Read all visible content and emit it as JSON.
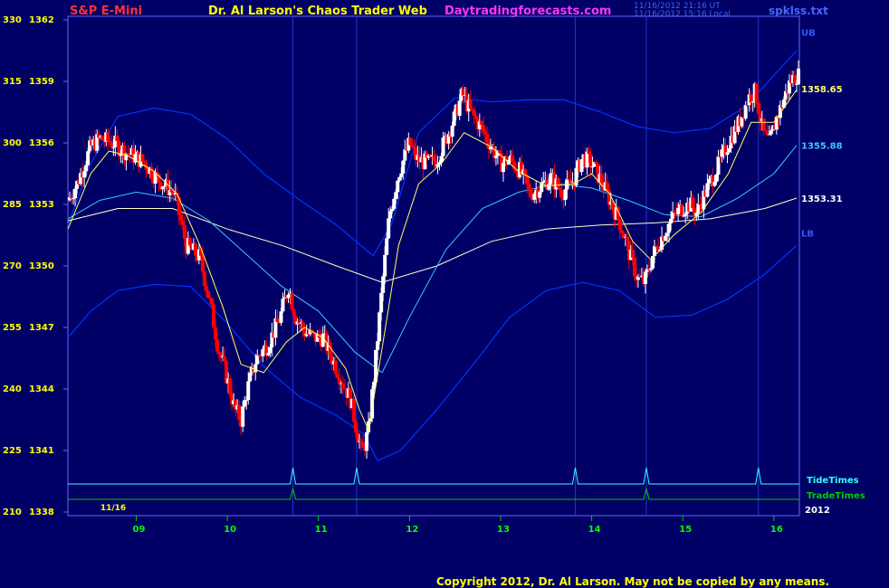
{
  "header": {
    "symbol": "S&P E-Mini",
    "title": "Dr. Al Larson's Chaos Trader Web",
    "site": "Daytradingforecasts.com",
    "stamp_line1": "11/16/2012 21:16 UT",
    "stamp_line2": "11/16/2012 15:16 Local",
    "file": "spklss.txt"
  },
  "copyright": "Copyright 2012, Dr. Al Larson. May not be copied by any means.",
  "colors": {
    "background": "#000066",
    "frame": "#6666ff",
    "up_candle": "#ffffff",
    "down_candle": "#ff0000",
    "ma_fast": "#ffff66",
    "ma_mid": "#33ccff",
    "ma_slow": "#ffffcc",
    "bands": "#0033ff",
    "tide": "#33ffff",
    "trade": "#00cc00",
    "symbol": "#ff3333",
    "site": "#ff33ff"
  },
  "chart_data": {
    "type": "candlestick",
    "left_axis_ticks": [
      "330 1362",
      "315 1359",
      "300 1356",
      "285 1353",
      "270 1350",
      "255 1347",
      "240 1344",
      "225 1341",
      "210 1338"
    ],
    "ylim": [
      1338,
      1362
    ],
    "x_ticks": [
      "09",
      "10",
      "11",
      "12",
      "13",
      "14",
      "15",
      "16"
    ],
    "date_label": "11/16",
    "year_label": "2012",
    "price_labels": [
      {
        "text": "UB",
        "value": 1361.4,
        "color": "#3355ff"
      },
      {
        "text": "1358.65",
        "value": 1358.65,
        "color": "#ffff66"
      },
      {
        "text": "1355.88",
        "value": 1355.88,
        "color": "#33ccff"
      },
      {
        "text": "1353.31",
        "value": 1353.31,
        "color": "#ffffff"
      },
      {
        "text": "LB",
        "value": 1351.6,
        "color": "#3355ff"
      }
    ],
    "series_labels": {
      "tide": "TideTimes",
      "trade": "TradeTimes"
    },
    "tide_times": [
      10.72,
      11.42,
      13.82,
      14.6,
      15.83
    ],
    "trade_times": [
      10.72,
      14.6
    ],
    "xlim": [
      8.25,
      16.28
    ],
    "close_path": [
      [
        8.25,
        1353.2
      ],
      [
        8.35,
        1354.0
      ],
      [
        8.5,
        1355.8
      ],
      [
        8.6,
        1356.2
      ],
      [
        8.75,
        1356.0
      ],
      [
        8.9,
        1355.5
      ],
      [
        9.0,
        1355.3
      ],
      [
        9.1,
        1355.0
      ],
      [
        9.2,
        1354.4
      ],
      [
        9.3,
        1354.0
      ],
      [
        9.42,
        1353.5
      ],
      [
        9.55,
        1351.0
      ],
      [
        9.7,
        1350.4
      ],
      [
        9.82,
        1348.0
      ],
      [
        9.9,
        1346.0
      ],
      [
        10.0,
        1344.5
      ],
      [
        10.08,
        1343.0
      ],
      [
        10.15,
        1342.5
      ],
      [
        10.22,
        1344.0
      ],
      [
        10.32,
        1345.5
      ],
      [
        10.45,
        1346.2
      ],
      [
        10.58,
        1347.5
      ],
      [
        10.67,
        1349.0
      ],
      [
        10.75,
        1347.5
      ],
      [
        10.85,
        1346.8
      ],
      [
        10.95,
        1346.5
      ],
      [
        11.05,
        1346.5
      ],
      [
        11.15,
        1345.5
      ],
      [
        11.25,
        1344.5
      ],
      [
        11.35,
        1343.5
      ],
      [
        11.42,
        1342.0
      ],
      [
        11.48,
        1340.8
      ],
      [
        11.55,
        1342.0
      ],
      [
        11.62,
        1345.0
      ],
      [
        11.7,
        1349.0
      ],
      [
        11.78,
        1352.5
      ],
      [
        11.88,
        1354.5
      ],
      [
        12.0,
        1356.0
      ],
      [
        12.08,
        1355.2
      ],
      [
        12.2,
        1355.0
      ],
      [
        12.3,
        1355.2
      ],
      [
        12.4,
        1356.2
      ],
      [
        12.5,
        1357.3
      ],
      [
        12.58,
        1358.4
      ],
      [
        12.67,
        1357.5
      ],
      [
        12.78,
        1356.8
      ],
      [
        12.9,
        1355.8
      ],
      [
        13.0,
        1355.0
      ],
      [
        13.1,
        1355.2
      ],
      [
        13.22,
        1354.6
      ],
      [
        13.32,
        1353.5
      ],
      [
        13.42,
        1353.8
      ],
      [
        13.55,
        1354.3
      ],
      [
        13.68,
        1353.6
      ],
      [
        13.8,
        1354.2
      ],
      [
        13.9,
        1355.3
      ],
      [
        14.0,
        1355.0
      ],
      [
        14.12,
        1354.0
      ],
      [
        14.22,
        1353.0
      ],
      [
        14.32,
        1352.0
      ],
      [
        14.42,
        1350.5
      ],
      [
        14.5,
        1349.4
      ],
      [
        14.58,
        1349.2
      ],
      [
        14.67,
        1350.5
      ],
      [
        14.78,
        1351.5
      ],
      [
        14.88,
        1352.3
      ],
      [
        14.98,
        1352.8
      ],
      [
        15.08,
        1353.0
      ],
      [
        15.15,
        1352.6
      ],
      [
        15.25,
        1353.6
      ],
      [
        15.38,
        1354.8
      ],
      [
        15.5,
        1356.0
      ],
      [
        15.62,
        1357.0
      ],
      [
        15.72,
        1358.2
      ],
      [
        15.8,
        1358.5
      ],
      [
        15.88,
        1356.5
      ],
      [
        15.95,
        1356.0
      ],
      [
        16.03,
        1357.2
      ],
      [
        16.1,
        1358.0
      ],
      [
        16.18,
        1359.0
      ],
      [
        16.25,
        1359.3
      ]
    ],
    "ma_fast_path": [
      [
        8.25,
        1351.8
      ],
      [
        8.5,
        1354.5
      ],
      [
        8.7,
        1355.6
      ],
      [
        8.9,
        1355.4
      ],
      [
        9.2,
        1354.6
      ],
      [
        9.45,
        1353.5
      ],
      [
        9.7,
        1351.0
      ],
      [
        9.95,
        1348.0
      ],
      [
        10.15,
        1345.2
      ],
      [
        10.4,
        1344.8
      ],
      [
        10.65,
        1346.3
      ],
      [
        10.85,
        1347.0
      ],
      [
        11.05,
        1346.5
      ],
      [
        11.3,
        1345.0
      ],
      [
        11.45,
        1343.0
      ],
      [
        11.55,
        1342.0
      ],
      [
        11.7,
        1346.0
      ],
      [
        11.88,
        1351.0
      ],
      [
        12.1,
        1354.0
      ],
      [
        12.35,
        1355.0
      ],
      [
        12.6,
        1356.5
      ],
      [
        12.9,
        1355.8
      ],
      [
        13.2,
        1354.6
      ],
      [
        13.5,
        1353.9
      ],
      [
        13.8,
        1354.0
      ],
      [
        14.0,
        1354.5
      ],
      [
        14.2,
        1353.5
      ],
      [
        14.45,
        1351.2
      ],
      [
        14.65,
        1350.3
      ],
      [
        14.9,
        1351.5
      ],
      [
        15.2,
        1352.6
      ],
      [
        15.5,
        1354.5
      ],
      [
        15.75,
        1357.0
      ],
      [
        16.0,
        1357.0
      ],
      [
        16.25,
        1358.6
      ]
    ],
    "ma_mid_path": [
      [
        8.25,
        1352.3
      ],
      [
        8.6,
        1353.2
      ],
      [
        9.0,
        1353.6
      ],
      [
        9.4,
        1353.3
      ],
      [
        9.8,
        1352.2
      ],
      [
        10.2,
        1350.6
      ],
      [
        10.6,
        1349.0
      ],
      [
        11.0,
        1347.8
      ],
      [
        11.4,
        1345.8
      ],
      [
        11.7,
        1344.8
      ],
      [
        12.0,
        1347.5
      ],
      [
        12.4,
        1350.8
      ],
      [
        12.8,
        1352.8
      ],
      [
        13.2,
        1353.6
      ],
      [
        13.6,
        1354.0
      ],
      [
        14.0,
        1353.8
      ],
      [
        14.4,
        1353.2
      ],
      [
        14.8,
        1352.5
      ],
      [
        15.2,
        1352.4
      ],
      [
        15.6,
        1353.3
      ],
      [
        16.0,
        1354.5
      ],
      [
        16.25,
        1355.88
      ]
    ],
    "ma_slow_path": [
      [
        8.25,
        1352.2
      ],
      [
        8.8,
        1352.8
      ],
      [
        9.4,
        1352.8
      ],
      [
        10.0,
        1351.8
      ],
      [
        10.6,
        1351.0
      ],
      [
        11.2,
        1350.0
      ],
      [
        11.7,
        1349.2
      ],
      [
        12.3,
        1350.0
      ],
      [
        12.9,
        1351.2
      ],
      [
        13.5,
        1351.8
      ],
      [
        14.1,
        1352.0
      ],
      [
        14.7,
        1352.1
      ],
      [
        15.3,
        1352.3
      ],
      [
        15.9,
        1352.8
      ],
      [
        16.25,
        1353.31
      ]
    ],
    "upper_band_path": [
      [
        8.25,
        1352.0
      ],
      [
        8.5,
        1355.0
      ],
      [
        8.8,
        1357.3
      ],
      [
        9.2,
        1357.7
      ],
      [
        9.6,
        1357.4
      ],
      [
        10.0,
        1356.2
      ],
      [
        10.4,
        1354.5
      ],
      [
        10.8,
        1353.2
      ],
      [
        11.2,
        1352.0
      ],
      [
        11.6,
        1350.5
      ],
      [
        11.8,
        1352.0
      ],
      [
        12.1,
        1356.5
      ],
      [
        12.5,
        1358.2
      ],
      [
        12.9,
        1358.0
      ],
      [
        13.3,
        1358.1
      ],
      [
        13.7,
        1358.1
      ],
      [
        14.1,
        1357.5
      ],
      [
        14.5,
        1356.8
      ],
      [
        14.9,
        1356.5
      ],
      [
        15.3,
        1356.7
      ],
      [
        15.7,
        1357.8
      ],
      [
        16.0,
        1359.3
      ],
      [
        16.25,
        1360.5
      ]
    ],
    "lower_band_path": [
      [
        8.25,
        1346.5
      ],
      [
        8.5,
        1347.8
      ],
      [
        8.8,
        1348.8
      ],
      [
        9.2,
        1349.1
      ],
      [
        9.6,
        1349.0
      ],
      [
        10.0,
        1347.2
      ],
      [
        10.4,
        1345.1
      ],
      [
        10.8,
        1343.6
      ],
      [
        11.2,
        1342.7
      ],
      [
        11.5,
        1341.8
      ],
      [
        11.65,
        1340.5
      ],
      [
        11.9,
        1341.0
      ],
      [
        12.3,
        1343.0
      ],
      [
        12.7,
        1345.2
      ],
      [
        13.1,
        1347.5
      ],
      [
        13.5,
        1348.8
      ],
      [
        13.9,
        1349.2
      ],
      [
        14.3,
        1348.8
      ],
      [
        14.7,
        1347.5
      ],
      [
        15.1,
        1347.6
      ],
      [
        15.5,
        1348.4
      ],
      [
        15.9,
        1349.6
      ],
      [
        16.25,
        1351.0
      ]
    ]
  }
}
